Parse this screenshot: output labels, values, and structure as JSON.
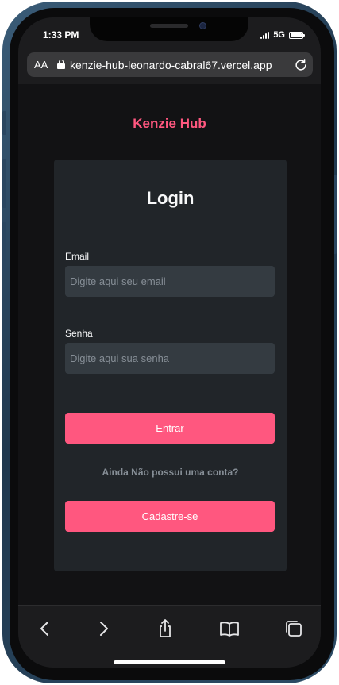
{
  "status_bar": {
    "time": "1:33 PM",
    "network": "5G",
    "signal_bars": 4,
    "battery_level": 1.0
  },
  "browser": {
    "text_size_label": "AA",
    "url": "kenzie-hub-leonardo-cabral67.vercel.app",
    "icons": [
      "lock-icon",
      "reload-icon"
    ]
  },
  "page": {
    "brand": "Kenzie Hub",
    "card_title": "Login",
    "email": {
      "label": "Email",
      "placeholder": "Digite aqui seu email",
      "value": ""
    },
    "password": {
      "label": "Senha",
      "placeholder": "Digite aqui sua senha",
      "value": ""
    },
    "login_button": "Entrar",
    "no_account_text": "Ainda Não possui uma conta?",
    "register_button": "Cadastre-se"
  },
  "toolbar": {
    "icons": [
      "back-icon",
      "forward-icon",
      "share-icon",
      "bookmarks-icon",
      "tabs-icon"
    ]
  },
  "colors": {
    "accent": "#ff577f",
    "background": "#121214",
    "card": "#212529",
    "input": "#343b41",
    "muted_text": "#868e96"
  }
}
